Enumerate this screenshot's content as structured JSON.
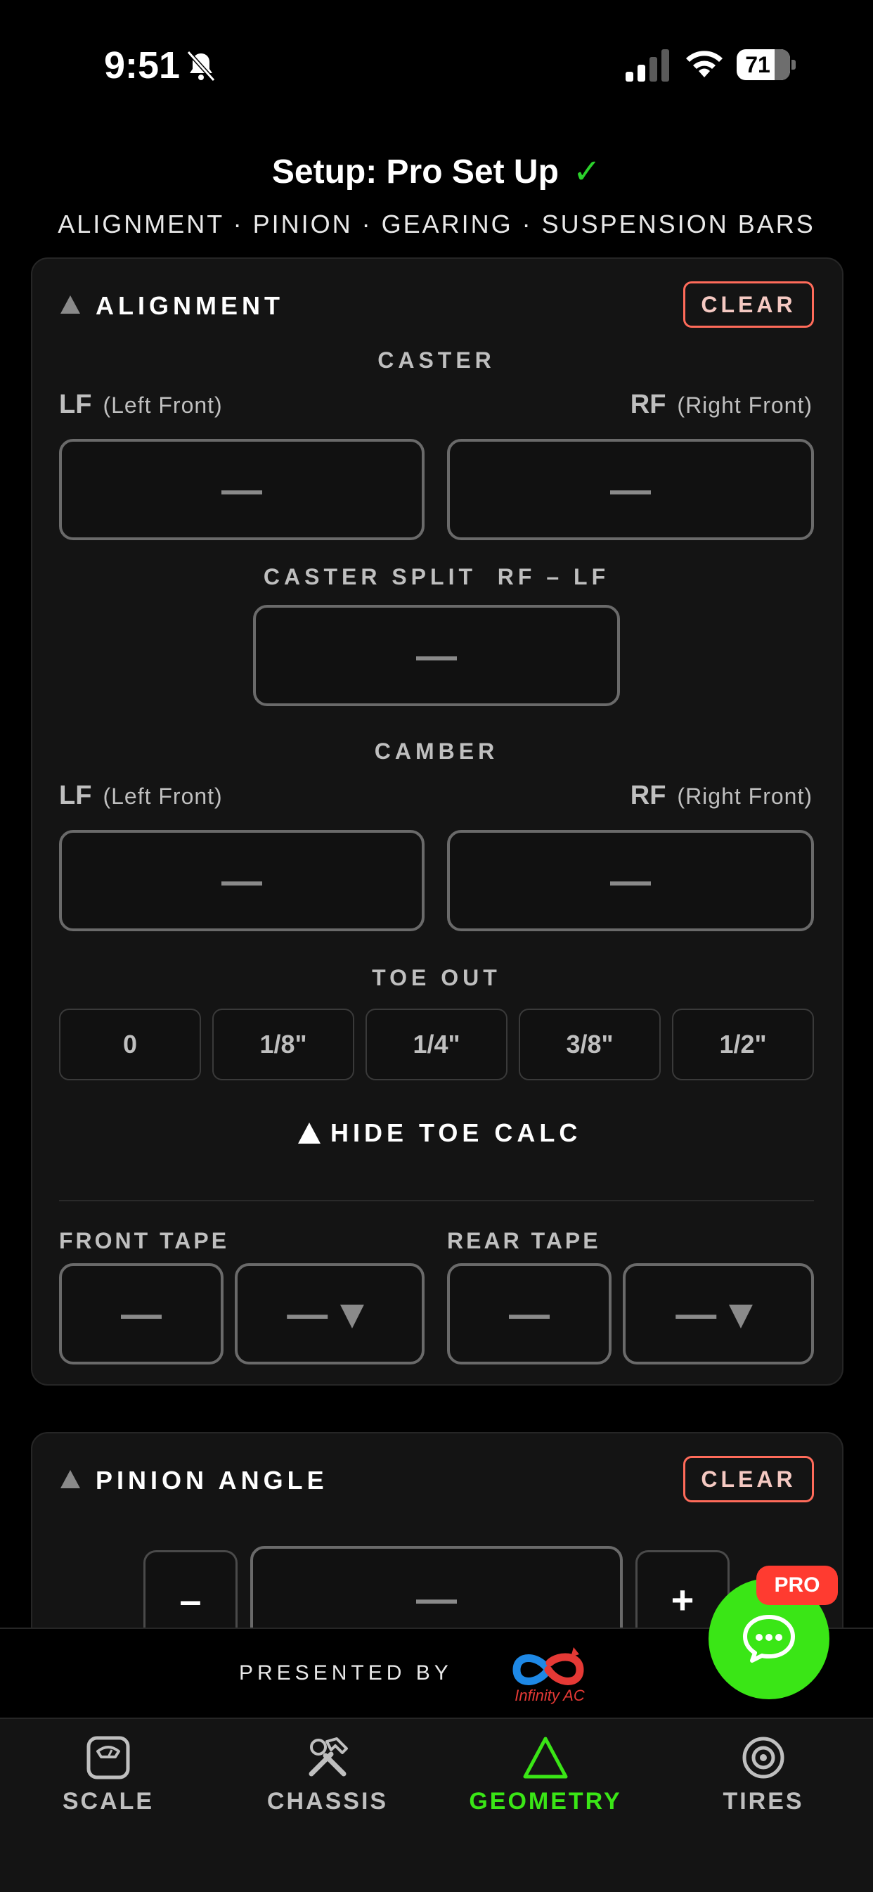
{
  "status_bar": {
    "time": "9:51",
    "battery": "71"
  },
  "header": {
    "title": "Setup: Pro Set Up",
    "check": "✓",
    "sections": "ALIGNMENT · PINION · GEARING · SUSPENSION BARS"
  },
  "alignment": {
    "title": "ALIGNMENT",
    "clear": "CLEAR",
    "caster": {
      "label": "CASTER",
      "lf_code": "LF",
      "lf_name": "(Left Front)",
      "lf_value": "—",
      "rf_code": "RF",
      "rf_name": "(Right Front)",
      "rf_value": "—"
    },
    "caster_split": {
      "label": "CASTER SPLIT  RF – LF",
      "value": "—"
    },
    "camber": {
      "label": "CAMBER",
      "lf_code": "LF",
      "lf_name": "(Left Front)",
      "lf_value": "—",
      "rf_code": "RF",
      "rf_name": "(Right Front)",
      "rf_value": "—"
    },
    "toe_out": {
      "label": "TOE OUT",
      "options": [
        "0",
        "1/8\"",
        "1/4\"",
        "3/8\"",
        "1/2\""
      ]
    },
    "hide_toe_calc": "HIDE TOE CALC",
    "front_tape": {
      "label": "FRONT TAPE",
      "value": "—",
      "fraction": "—"
    },
    "rear_tape": {
      "label": "REAR TAPE",
      "value": "—",
      "fraction": "—"
    }
  },
  "pinion": {
    "title": "PINION ANGLE",
    "clear": "CLEAR",
    "minus": "–",
    "value": "—",
    "plus": "+"
  },
  "presented_by": {
    "label": "PRESENTED BY",
    "sponsor": "Infinity AC"
  },
  "chat": {
    "badge": "PRO"
  },
  "tabs": [
    {
      "label": "SCALE",
      "icon": "scale-icon",
      "active": false
    },
    {
      "label": "CHASSIS",
      "icon": "tools-icon",
      "active": false
    },
    {
      "label": "GEOMETRY",
      "icon": "triangle-icon",
      "active": true
    },
    {
      "label": "TIRES",
      "icon": "target-icon",
      "active": false
    }
  ],
  "colors": {
    "accent": "#3ae616",
    "clear_border": "#ff6b5a",
    "pro_badge": "#ff3b30",
    "check": "#2bd12b"
  }
}
